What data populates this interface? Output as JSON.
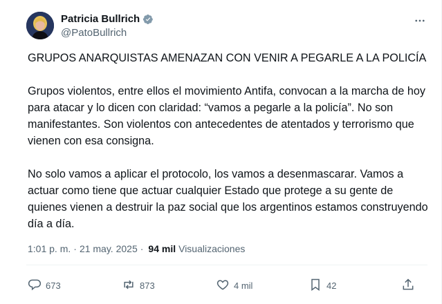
{
  "author": {
    "display_name": "Patricia Bullrich",
    "handle": "@PatoBullrich"
  },
  "tweet": {
    "paragraphs": [
      "GRUPOS ANARQUISTAS AMENAZAN CON VENIR A PEGARLE A LA POLICÍA",
      "Grupos violentos, entre ellos el movimiento Antifa, convocan a la marcha de hoy para atacar y lo dicen con claridad: “vamos a pegarle a la policía”. No son manifestantes. Son violentos con antecedentes de atentados y terrorismo que vienen con esa consigna.",
      "No solo vamos a aplicar el protocolo, los vamos a desenmascarar. Vamos a actuar como tiene que actuar cualquier Estado que protege a su gente de quienes vienen a destruir la paz social que los argentinos estamos construyendo día a día."
    ],
    "time": "1:01 p. m.",
    "separator": "·",
    "date": "21 may. 2025",
    "views_count": "94 mil",
    "views_label": "Visualizaciones"
  },
  "actions": {
    "replies": "673",
    "reposts": "873",
    "likes": "4 mil",
    "bookmarks": "42"
  },
  "icons": {
    "verified": "verified-badge-icon",
    "more": "more-options-icon",
    "reply": "reply-icon",
    "repost": "repost-icon",
    "like": "heart-icon",
    "bookmark": "bookmark-icon",
    "share": "share-icon"
  },
  "colors": {
    "text": "#0f1419",
    "secondary": "#536471",
    "verified": "#829aab"
  }
}
